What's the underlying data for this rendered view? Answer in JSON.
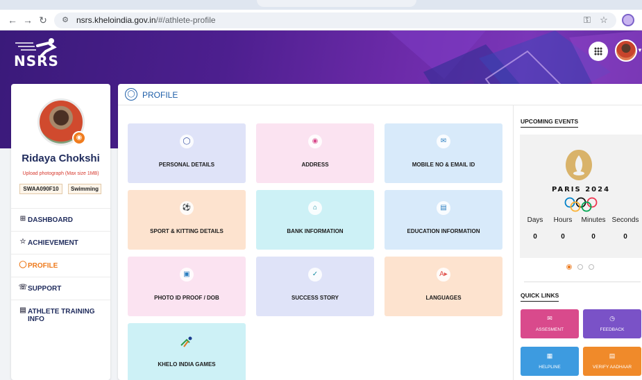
{
  "browser": {
    "url_host": "nsrs.kheloindia.gov.in",
    "url_path": "/#/athlete-profile"
  },
  "header": {
    "logo_text": "NSRS"
  },
  "athlete": {
    "name": "Ridaya Chokshi",
    "upload_note": "Upload photograph (Max size 1MB)",
    "id": "SWAA090F10",
    "sport": "Swimming"
  },
  "sidebar": {
    "items": [
      {
        "label": "DASHBOARD",
        "icon": "grid-icon"
      },
      {
        "label": "ACHIEVEMENT",
        "icon": "trophy-icon"
      },
      {
        "label": "PROFILE",
        "icon": "user-icon",
        "active": true
      },
      {
        "label": "SUPPORT",
        "icon": "support-icon"
      },
      {
        "label": "ATHLETE TRAINING INFO",
        "icon": "training-icon"
      }
    ]
  },
  "profile": {
    "title": "PROFILE",
    "tiles": [
      {
        "label": "PERSONAL DETAILS",
        "color": "#dfe3f8",
        "icon": "person-icon"
      },
      {
        "label": "ADDRESS",
        "color": "#fbe3f1",
        "icon": "location-pin-icon"
      },
      {
        "label": "MOBILE NO & EMAIL ID",
        "color": "#d8eafa",
        "icon": "mail-icon"
      },
      {
        "label": "SPORT & KITTING DETAILS",
        "color": "#fde3cf",
        "icon": "ball-icon"
      },
      {
        "label": "BANK INFORMATION",
        "color": "#cdf1f6",
        "icon": "bank-icon"
      },
      {
        "label": "EDUCATION INFORMATION",
        "color": "#d8eafa",
        "icon": "book-icon"
      },
      {
        "label": "PHOTO ID PROOF / DOB",
        "color": "#fbe3f1",
        "icon": "image-icon"
      },
      {
        "label": "SUCCESS STORY",
        "color": "#dfe3f8",
        "icon": "check-circle-icon"
      },
      {
        "label": "LANGUAGES",
        "color": "#fde3cf",
        "icon": "translate-icon"
      },
      {
        "label": "KHELO INDIA GAMES",
        "color": "#cdf1f6",
        "icon": "khelo-india-logo-icon"
      }
    ]
  },
  "events": {
    "title": "UPCOMING EVENTS",
    "event_name": "PARIS 2024",
    "countdown": [
      {
        "label": "Days",
        "value": "0"
      },
      {
        "label": "Hours",
        "value": "0"
      },
      {
        "label": "Minutes",
        "value": "0"
      },
      {
        "label": "Seconds",
        "value": "0"
      }
    ],
    "slides_total": 3,
    "slide_active": 1
  },
  "quick_links": {
    "title": "QUICK LINKS",
    "items": [
      {
        "label": "ASSESMENT",
        "color": "#d94a8c",
        "icon": "mail-icon"
      },
      {
        "label": "FEEDBACK",
        "color": "#7a52c7",
        "icon": "clock-icon"
      },
      {
        "label": "HELPLINE",
        "color": "#3d9be0",
        "icon": "calendar-icon"
      },
      {
        "label": "VERIFY AADHAAR",
        "color": "#f08a2a",
        "icon": "document-icon"
      }
    ]
  }
}
